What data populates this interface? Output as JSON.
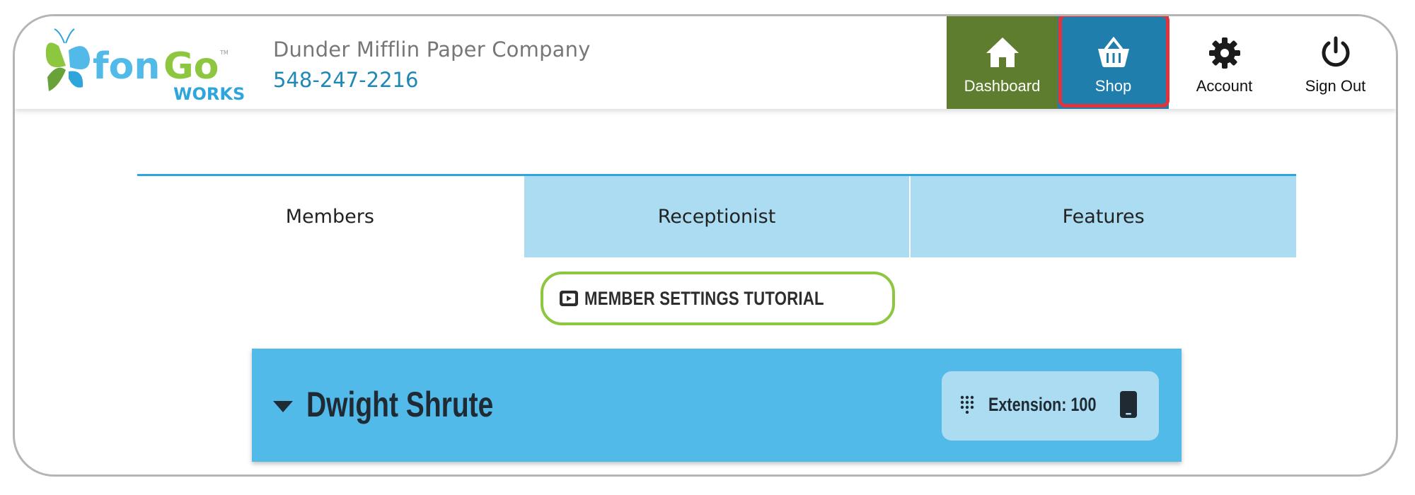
{
  "app": {
    "logo_text": "fonGo WORKS",
    "company_name": "Dunder Mifflin Paper Company",
    "company_phone": "548-247-2216"
  },
  "nav": [
    {
      "label": "Dashboard",
      "icon": "home-icon",
      "color": "#5e7d2e"
    },
    {
      "label": "Shop",
      "icon": "basket-icon",
      "color": "#1f7eab",
      "highlighted": true
    },
    {
      "label": "Account",
      "icon": "gear-icon"
    },
    {
      "label": "Sign Out",
      "icon": "power-icon"
    }
  ],
  "tabs": [
    {
      "label": "Members",
      "active": true
    },
    {
      "label": "Receptionist",
      "active": false
    },
    {
      "label": "Features",
      "active": false
    }
  ],
  "tutorial": {
    "label": "MEMBER SETTINGS TUTORIAL",
    "icon": "video-play-icon"
  },
  "member": {
    "name": "Dwight Shrute",
    "extension_label": "Extension: 100",
    "expanded": true
  },
  "colors": {
    "accent_blue": "#52bae9",
    "tab_inactive": "#abdcf1",
    "dashboard_green": "#5e7d2e",
    "shop_blue": "#1f7eab",
    "tutorial_border": "#8dc63f",
    "highlight_red": "#e2333d"
  }
}
